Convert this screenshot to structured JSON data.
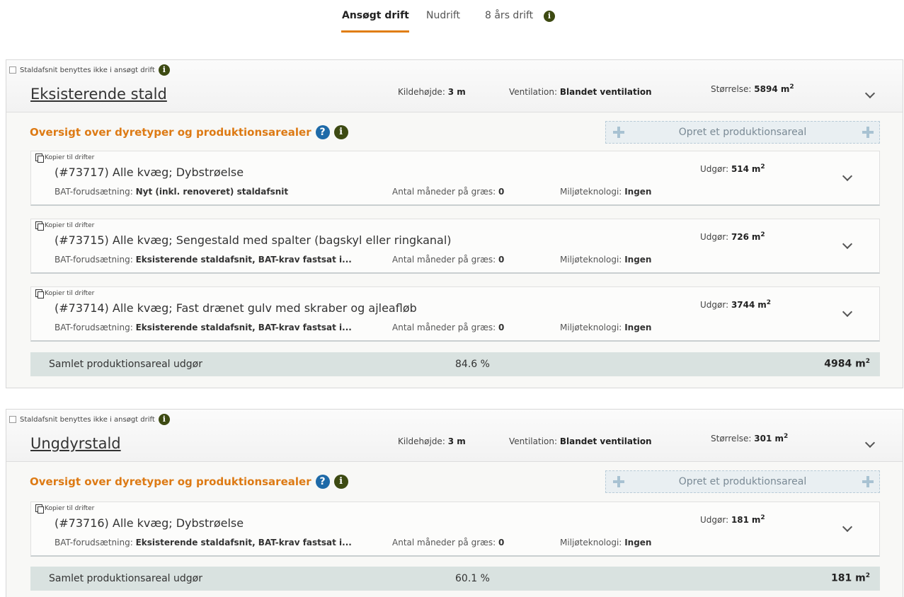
{
  "tabs": [
    {
      "label": "Ansøgt drift"
    },
    {
      "label": "Nudrift"
    },
    {
      "label": "8 års drift"
    }
  ],
  "labels": {
    "checkbox": "Staldafsnit benyttes ikke i ansøgt drift",
    "kildehojde": "Kildehøjde:",
    "ventilation": "Ventilation:",
    "storrelse": "Størrelse:",
    "overview": "Oversigt over dyretyper og produktionsarealer",
    "create": "Opret et produktionsareal",
    "copy": "Kopier til drifter",
    "bat": "BAT-forudsætning:",
    "months": "Antal måneder på græs:",
    "tech": "Miljøteknologi:",
    "udgor": "Udgør:",
    "total": "Samlet produktionsareal udgør",
    "unit": "m"
  },
  "stables": [
    {
      "name": "Eksisterende stald",
      "kildehojde": "3 m",
      "ventilation": "Blandet ventilation",
      "storrelse": "5894",
      "areas": [
        {
          "title": "(#73717) Alle kvæg; Dybstrøelse",
          "bat": "Nyt (inkl. renoveret) staldafsnit",
          "months": "0",
          "tech": "Ingen",
          "udgor": "514"
        },
        {
          "title": "(#73715) Alle kvæg; Sengestald med spalter (bagskyl eller ringkanal)",
          "bat": "Eksisterende staldafsnit, BAT-krav fastsat i...",
          "months": "0",
          "tech": "Ingen",
          "udgor": "726"
        },
        {
          "title": "(#73714) Alle kvæg; Fast drænet gulv med skraber og ajleafløb",
          "bat": "Eksisterende staldafsnit, BAT-krav fastsat i...",
          "months": "0",
          "tech": "Ingen",
          "udgor": "3744"
        }
      ],
      "total_pct": "84.6 %",
      "total_sum": "4984"
    },
    {
      "name": "Ungdyrstald",
      "kildehojde": "3 m",
      "ventilation": "Blandet ventilation",
      "storrelse": "301",
      "areas": [
        {
          "title": "(#73716) Alle kvæg; Dybstrøelse",
          "bat": "Eksisterende staldafsnit, BAT-krav fastsat i...",
          "months": "0",
          "tech": "Ingen",
          "udgor": "181"
        }
      ],
      "total_pct": "60.1 %",
      "total_sum": "181"
    }
  ]
}
